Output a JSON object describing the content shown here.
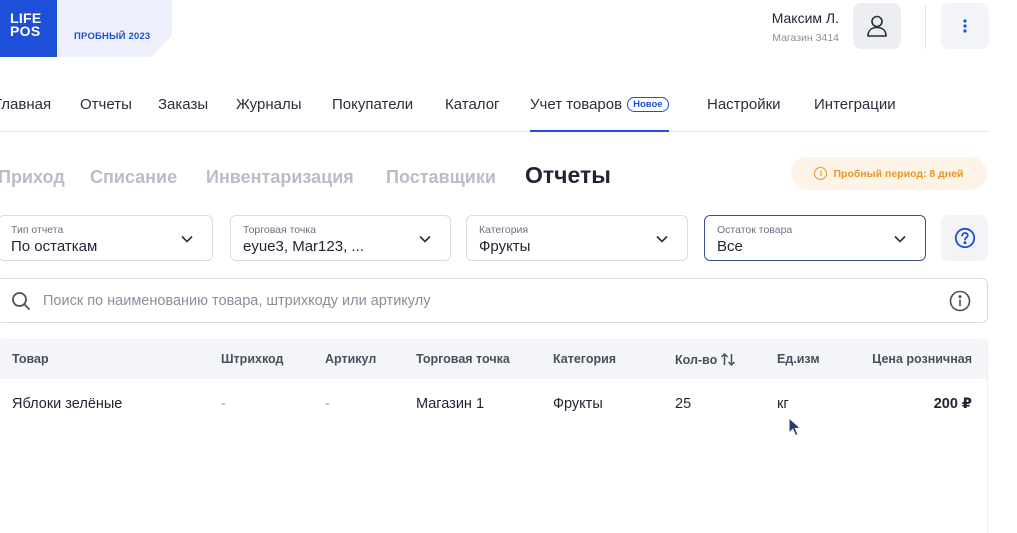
{
  "header": {
    "logo_line1": "LIFE",
    "logo_line2": "POS",
    "trial_badge": "ПРОБНЫЙ 2023",
    "user_name": "Максим Л.",
    "user_store": "Магазин 3414"
  },
  "nav": {
    "items": [
      {
        "label": "Главная"
      },
      {
        "label": "Отчеты"
      },
      {
        "label": "Заказы"
      },
      {
        "label": "Журналы"
      },
      {
        "label": "Покупатели"
      },
      {
        "label": "Каталог"
      },
      {
        "label": "Учет товаров",
        "badge": "Новое",
        "active": true
      },
      {
        "label": "Настройки"
      },
      {
        "label": "Интеграции"
      }
    ]
  },
  "subnav": {
    "items": [
      {
        "label": "Приход"
      },
      {
        "label": "Списание"
      },
      {
        "label": "Инвентаризация"
      },
      {
        "label": "Поставщики"
      },
      {
        "label": "Отчеты",
        "active": true
      }
    ],
    "trial_notice": "Пробный период: 8 дней"
  },
  "filters": [
    {
      "label": "Тип отчета",
      "value": "По остаткам"
    },
    {
      "label": "Торговая точка",
      "value": "eyue3, Mar123, ..."
    },
    {
      "label": "Категория",
      "value": "Фрукты"
    },
    {
      "label": "Остаток товара",
      "value": "Все"
    }
  ],
  "search": {
    "placeholder": "Поиск по наименованию товара, штрихкоду или артикулу"
  },
  "table": {
    "columns": [
      "Товар",
      "Штрихкод",
      "Артикул",
      "Торговая точка",
      "Категория",
      "Кол-во",
      "Ед.изм",
      "Цена розничная"
    ],
    "rows": [
      {
        "name": "Яблоки зелёные",
        "barcode": "-",
        "sku": "-",
        "store": "Магазин 1",
        "category": "Фрукты",
        "qty": "25",
        "unit": "кг",
        "price": "200 ₽"
      }
    ]
  },
  "icons": {
    "avatar": "user-icon",
    "more": "vertical-dots-icon",
    "help": "question-circle-icon",
    "search": "search-icon",
    "info": "info-icon",
    "sort": "sort-arrows-icon",
    "chevron": "chevron-down-icon"
  },
  "colors": {
    "accent": "#1d4fd8",
    "trial_orange": "#e8962b",
    "muted_tab": "#b9bdc8"
  }
}
